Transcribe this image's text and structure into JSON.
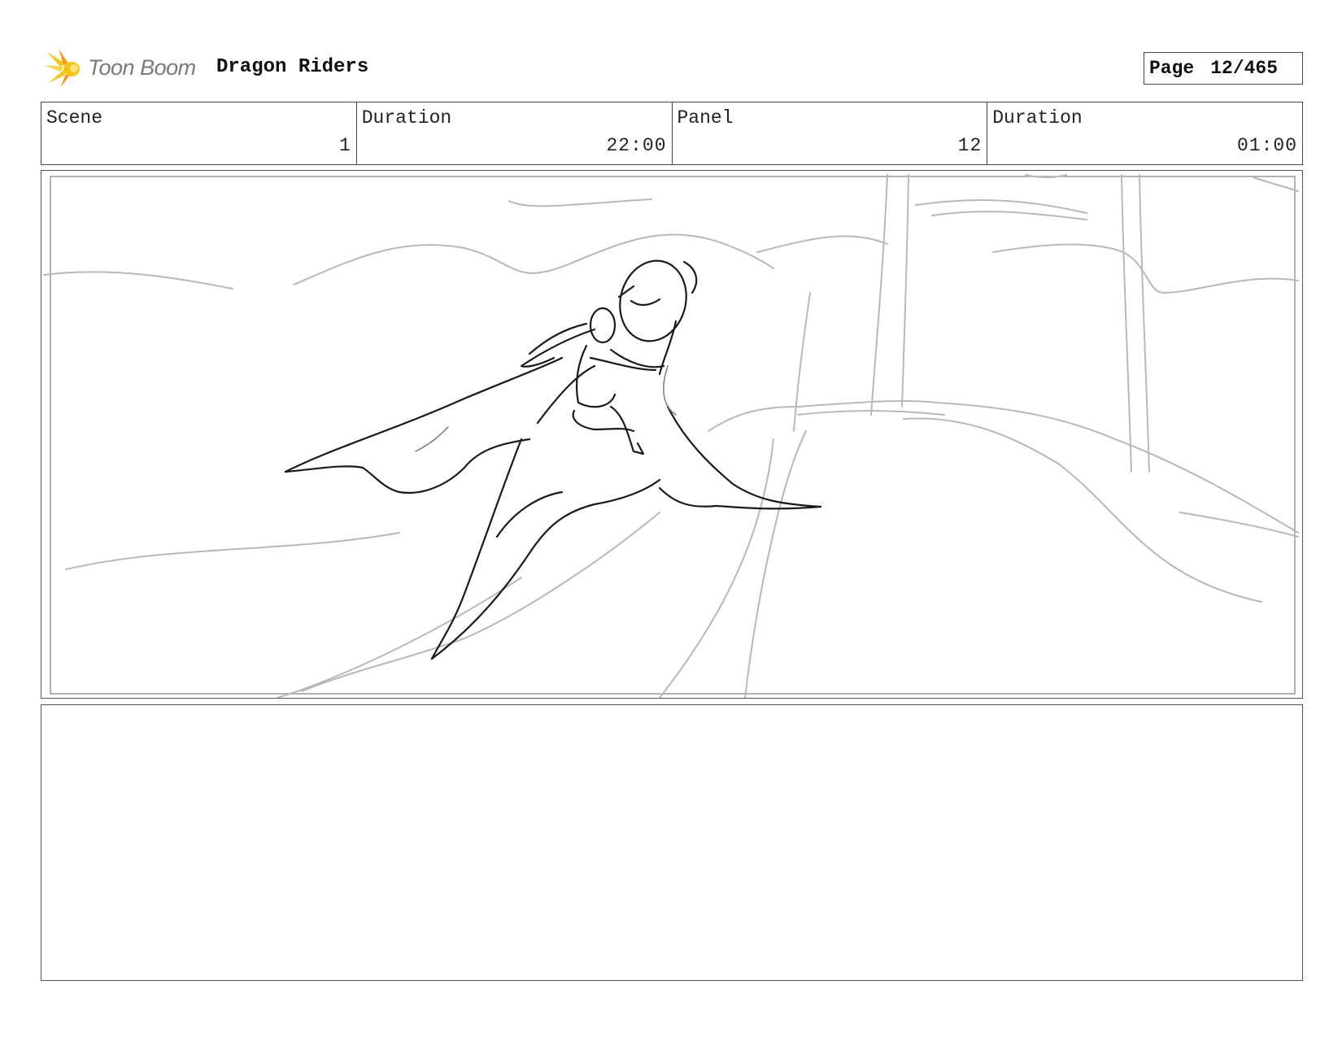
{
  "header": {
    "logo_text": "Toon Boom",
    "logo_icon": "toon-boom-burst-icon",
    "project_title": "Dragon Riders",
    "page_label": "Page",
    "page_value": "12/465"
  },
  "info": [
    {
      "label": "Scene",
      "value": "1"
    },
    {
      "label": "Duration",
      "value": "22:00"
    },
    {
      "label": "Panel",
      "value": "12"
    },
    {
      "label": "Duration",
      "value": "01:00"
    }
  ],
  "colors": {
    "logo_yellow": "#f5c518",
    "logo_orange": "#f29a1b",
    "sketch_dark": "#1a1a1a",
    "sketch_light": "#b5b5b5",
    "border": "#444444"
  }
}
